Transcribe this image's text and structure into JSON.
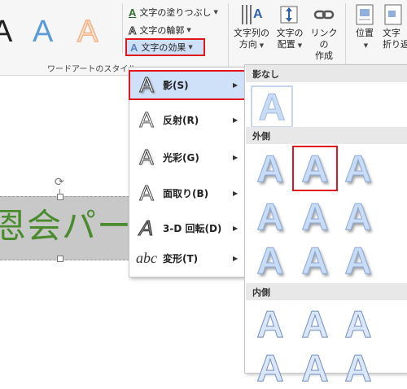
{
  "ribbon": {
    "text_fill_label": "文字の塗りつぶし",
    "text_outline_label": "文字の輪郭",
    "text_effects_label": "文字の効果",
    "wordart_group_label": "ワードアートのスタイル",
    "text_direction_label": [
      "文字列の",
      "方向"
    ],
    "text_align_label": [
      "文字の",
      "配置"
    ],
    "create_link_label": [
      "リンクの",
      "作成"
    ],
    "position_label": "位置",
    "wrap_text_label": [
      "文字",
      "折り返"
    ],
    "wordart_samples": [
      "A",
      "A",
      "A"
    ],
    "colors": {
      "sample_blue": "#5b9bd5",
      "sample_orange": "#f4b183",
      "highlight_red": "#e2141c"
    }
  },
  "document": {
    "textbox_text": "恩会パー",
    "text_color": "#4b8b2f"
  },
  "submenu": {
    "items": [
      {
        "icon": "A",
        "label": "影(S)",
        "icon_name": "shadow-icon"
      },
      {
        "icon": "A",
        "label": "反射(R)",
        "icon_name": "reflection-icon"
      },
      {
        "icon": "A",
        "label": "光彩(G)",
        "icon_name": "glow-icon"
      },
      {
        "icon": "A",
        "label": "面取り(B)",
        "icon_name": "bevel-icon"
      },
      {
        "icon": "A",
        "label": "3-D 回転(D)",
        "icon_name": "3d-rotation-icon"
      },
      {
        "icon": "abc",
        "label": "変形(T)",
        "icon_name": "transform-icon"
      }
    ]
  },
  "gallery": {
    "no_shadow_label": "影なし",
    "outer_label": "外側",
    "inner_label": "内側",
    "tile_glyph": "A"
  }
}
